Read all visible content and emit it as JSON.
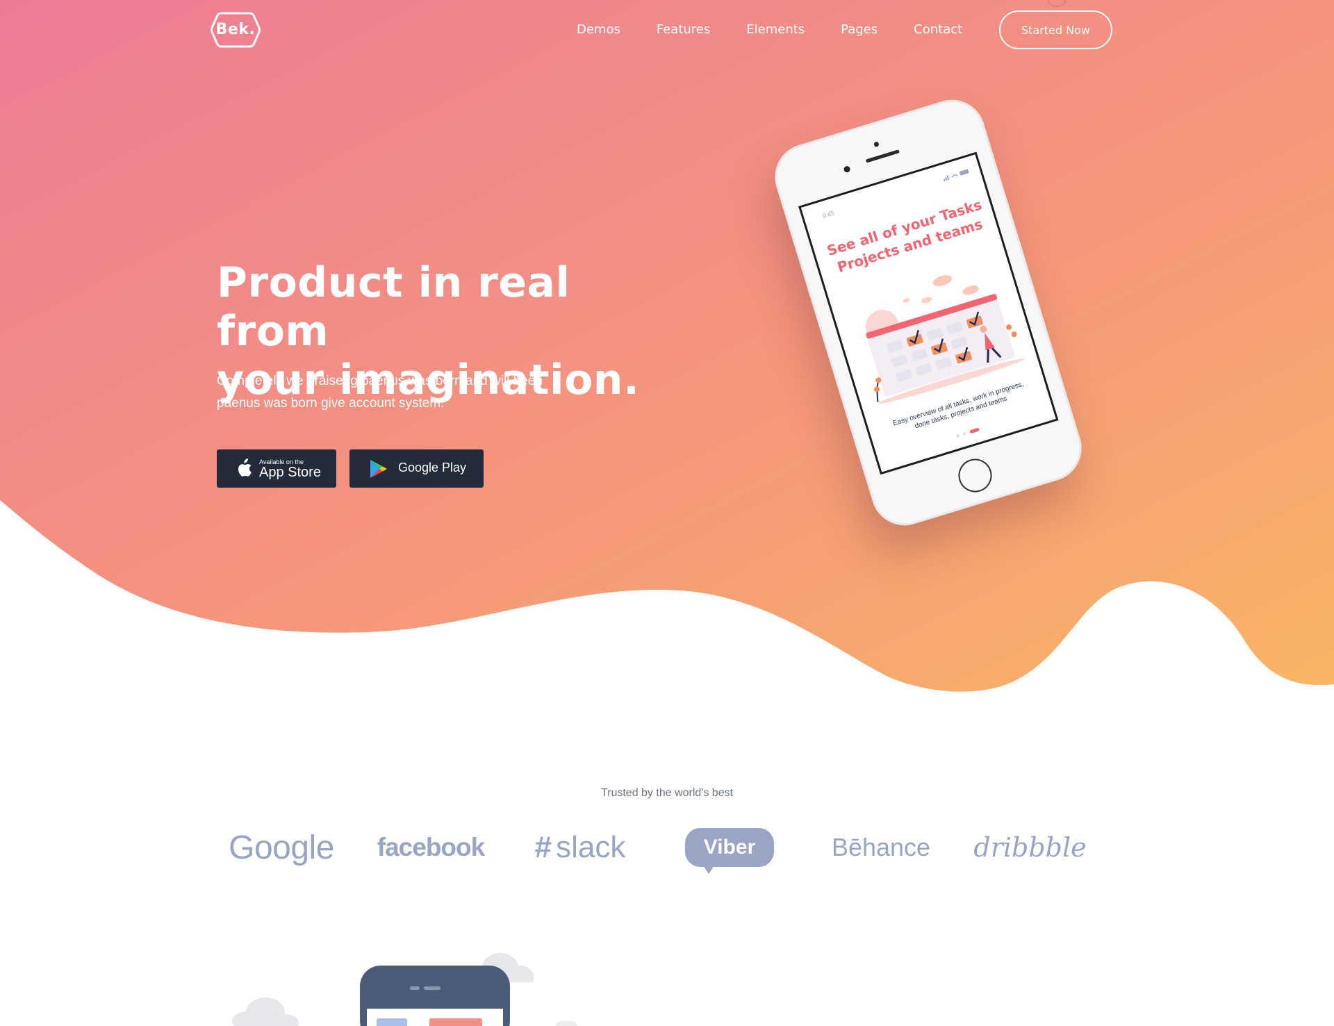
{
  "brand": {
    "logo_text": "Bek."
  },
  "nav": {
    "items": [
      "Demos",
      "Features",
      "Elements",
      "Pages",
      "Contact"
    ],
    "cta_label": "Started Now"
  },
  "hero": {
    "title_line1": "Product in real from",
    "title_line2": "your imagination.",
    "subtitle_line1": "Completely we praiseng paenus was born and will been",
    "subtitle_line2": "paenus was born give account system.",
    "app_store": {
      "small": "Available on the",
      "big": "App Store"
    },
    "google_play": {
      "label": "Google Play"
    }
  },
  "phone_screen": {
    "time": "9:45",
    "title_line1": "See all of your Tasks",
    "title_line2": "Projects and teams",
    "caption_line1": "Easy overview of all tasks, work in progress,",
    "caption_line2": "done tasks, projects and teams"
  },
  "trusted": {
    "heading": "Trusted by the world's best",
    "brands": [
      "Google",
      "facebook",
      "slack",
      "Viber",
      "Bēhance",
      "dribbble"
    ]
  },
  "colors": {
    "gradient_start": "#ef7f93",
    "gradient_end": "#f8b066",
    "dark_button": "#232b38",
    "brand_gray": "#9aa4c4",
    "phone_accent": "#f06570"
  }
}
